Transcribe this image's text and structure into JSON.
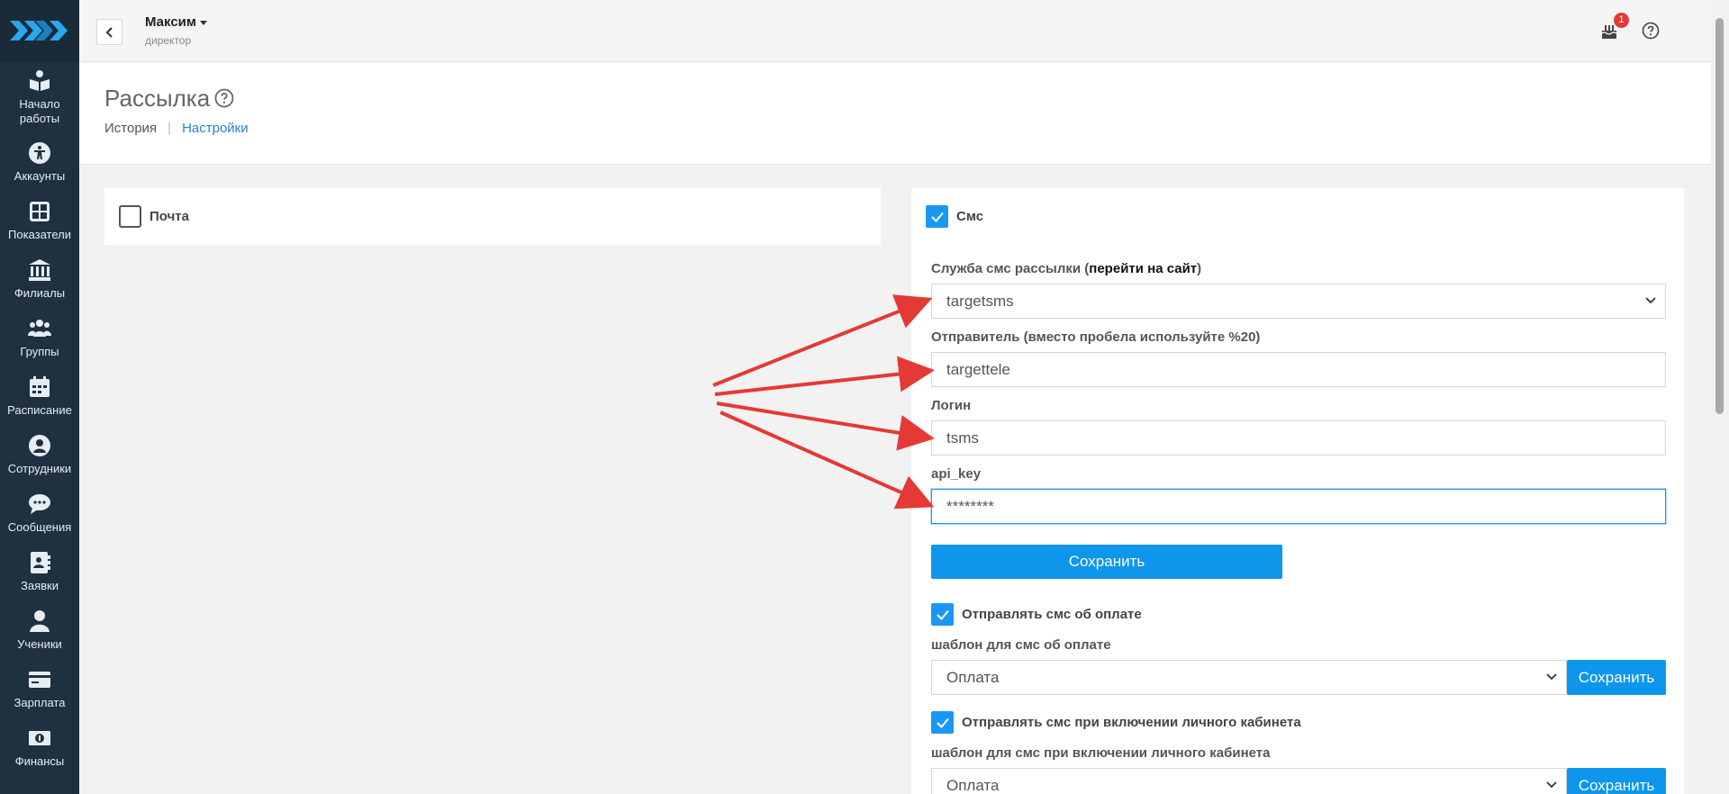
{
  "sidebar": {
    "items": [
      {
        "label": "Начало работы",
        "icon": "book-reader-icon"
      },
      {
        "label": "Аккаунты",
        "icon": "accessibility-icon"
      },
      {
        "label": "Показатели",
        "icon": "dashboard-grid-icon"
      },
      {
        "label": "Филиалы",
        "icon": "bank-building-icon"
      },
      {
        "label": "Группы",
        "icon": "users-group-icon"
      },
      {
        "label": "Расписание",
        "icon": "calendar-icon"
      },
      {
        "label": "Сотрудники",
        "icon": "user-circle-icon"
      },
      {
        "label": "Сообщения",
        "icon": "chat-bubble-icon"
      },
      {
        "label": "Заявки",
        "icon": "address-book-icon"
      },
      {
        "label": "Ученики",
        "icon": "user-icon"
      },
      {
        "label": "Зарплата",
        "icon": "credit-card-icon"
      },
      {
        "label": "Финансы",
        "icon": "money-bill-icon"
      }
    ]
  },
  "topbar": {
    "user_name": "Максим",
    "user_role": "директор",
    "notification_count": "1"
  },
  "page": {
    "title": "Рассылка",
    "subnav": {
      "history": "История",
      "separator": "|",
      "settings": "Настройки"
    }
  },
  "mail_panel": {
    "label": "Почта",
    "checked": false
  },
  "sms_panel": {
    "label": "Смс",
    "checked": true,
    "service_label_prefix": "Служба смс рассылки (",
    "service_label_link": "перейти на сайт",
    "service_label_suffix": ")",
    "service_value": "targetsms",
    "sender_label": "Отправитель (вместо пробела используйте %20)",
    "sender_value": "targettele",
    "login_label": "Логин",
    "login_value": "tsms",
    "api_key_label": "api_key",
    "api_key_value": "********",
    "save_label": "Сохранить",
    "payment_check_label": "Отправлять смс об оплате",
    "payment_template_label": "шаблон для смс об оплате",
    "payment_template_value": "Оплата",
    "payment_save_label": "Сохранить",
    "cabinet_check_label": "Отправлять смс при включении личного кабинета",
    "cabinet_template_label": "шаблон для смс при включении личного кабинета",
    "cabinet_template_value": "Оплата",
    "cabinet_save_label": "Сохранить"
  },
  "colors": {
    "sidebar_bg": "#1f3040",
    "accent": "#0d96ec",
    "link": "#2a7fd4",
    "annotation_arrow": "#e53935"
  }
}
